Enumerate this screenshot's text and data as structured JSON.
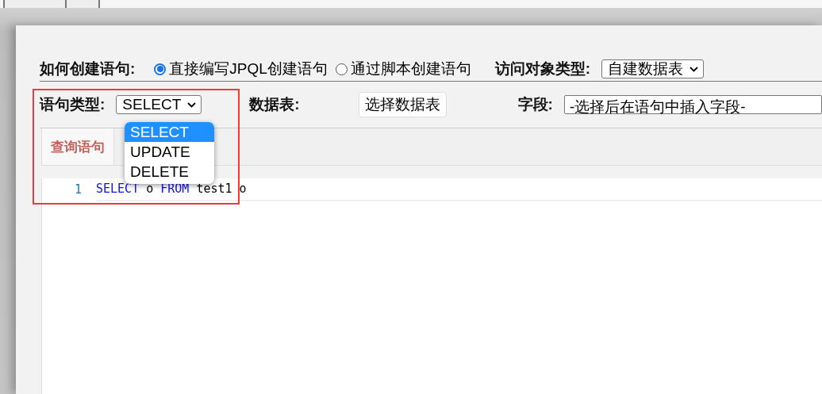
{
  "create_method": {
    "label": "如何创建语句:",
    "options": [
      {
        "label": "直接编写JPQL创建语句",
        "selected": true
      },
      {
        "label": "通过脚本创建语句",
        "selected": false
      }
    ]
  },
  "object_type": {
    "label": "访问对象类型:",
    "value": "自建数据表"
  },
  "statement_type": {
    "label": "语句类型:",
    "value": "SELECT",
    "expanded": true,
    "options": [
      {
        "label": "SELECT",
        "selected": true
      },
      {
        "label": "UPDATE",
        "selected": false
      },
      {
        "label": "DELETE",
        "selected": false
      }
    ]
  },
  "data_table": {
    "label": "数据表:",
    "button": "选择数据表"
  },
  "field": {
    "label": "字段:",
    "value": "-选择后在语句中插入字段-"
  },
  "tabs": [
    {
      "label": "查询语句",
      "selected": true
    }
  ],
  "editor": {
    "lines": [
      {
        "number": "1",
        "tokens": [
          {
            "text": "SELECT",
            "kind": "keyword"
          },
          {
            "text": " o ",
            "kind": "plain"
          },
          {
            "text": "FROM",
            "kind": "keyword"
          },
          {
            "text": " test1 o",
            "kind": "plain"
          }
        ]
      }
    ]
  }
}
